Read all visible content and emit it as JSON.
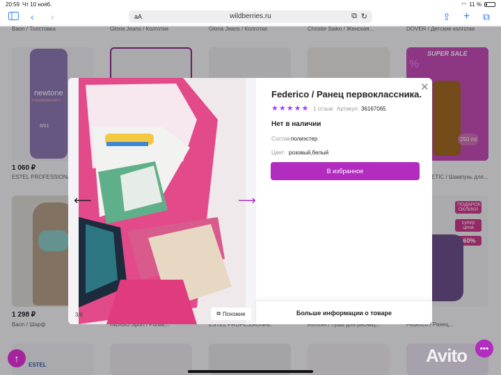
{
  "status_bar": {
    "time": "20:59",
    "date": "Чт 10 нояб.",
    "battery": "11 %"
  },
  "browser": {
    "aa": "aA",
    "url": "wildberries.ru"
  },
  "background": {
    "top_labels": [
      "Baon / Толстовка",
      "Gloria Jeans / Колготки",
      "Gloria Jeans / Колготки",
      "Christie Saiko / Женская...",
      "DOVER / Детские колготки"
    ],
    "row1": [
      {
        "price": "1 060 ₽",
        "name": "ESTEL PROFESSIONAL"
      },
      {
        "price": "",
        "name": ""
      },
      {
        "price": "",
        "name": ""
      },
      {
        "price": "",
        "name": ""
      },
      {
        "price": "",
        "name": "ETIC / Шампунь для..."
      }
    ],
    "row2": [
      {
        "price": "1 298 ₽",
        "name": "Baon / Шарф"
      },
      {
        "price": "",
        "name": "INDIGO Sport / Ролик..."
      },
      {
        "price": "",
        "name": "ESTEL PROFESSIONAL"
      },
      {
        "price": "",
        "name": "Rimmel / Тушь для ресниц..."
      },
      {
        "price": "",
        "name": "Federico / Ранец..."
      }
    ],
    "promo": {
      "super_sale": "SUPER SALE",
      "volume": "250 ml",
      "gift": "ПОДАРОК ОКЛИКИ",
      "super_price": "супер цена",
      "discount": "-60%",
      "percent": "%"
    },
    "brand_texts": {
      "newtone": "newtone",
      "thermo": "THERMORERATH",
      "shade": "8/61",
      "estel": "ESTEL"
    }
  },
  "modal": {
    "title": "Federico / Ранец первоклассника...",
    "stars": "★★★★★",
    "reviews": "1 отзыв",
    "article_label": "Артикул:",
    "article_value": "36167065",
    "stock": "Нет в наличии",
    "composition_label": "Состав:",
    "composition_value": "полиэстер",
    "color_label": "Цвет:",
    "color_value": "розовый,белый",
    "favorite_button": "В избранное",
    "more_info": "Больше информации о товаре",
    "counter": "3/6",
    "similar": "Похожие",
    "close": "✕"
  },
  "watermark": "Avito",
  "colors": {
    "accent": "#b12cbf",
    "stars": "#a73afd"
  },
  "icons": [
    "sidebar-icon",
    "back-icon",
    "forward-icon",
    "share-icon",
    "new-tab-icon",
    "tabs-icon",
    "close-icon",
    "arrow-left-icon",
    "arrow-right-icon",
    "similar-icon",
    "scroll-up-icon",
    "chat-icon"
  ]
}
